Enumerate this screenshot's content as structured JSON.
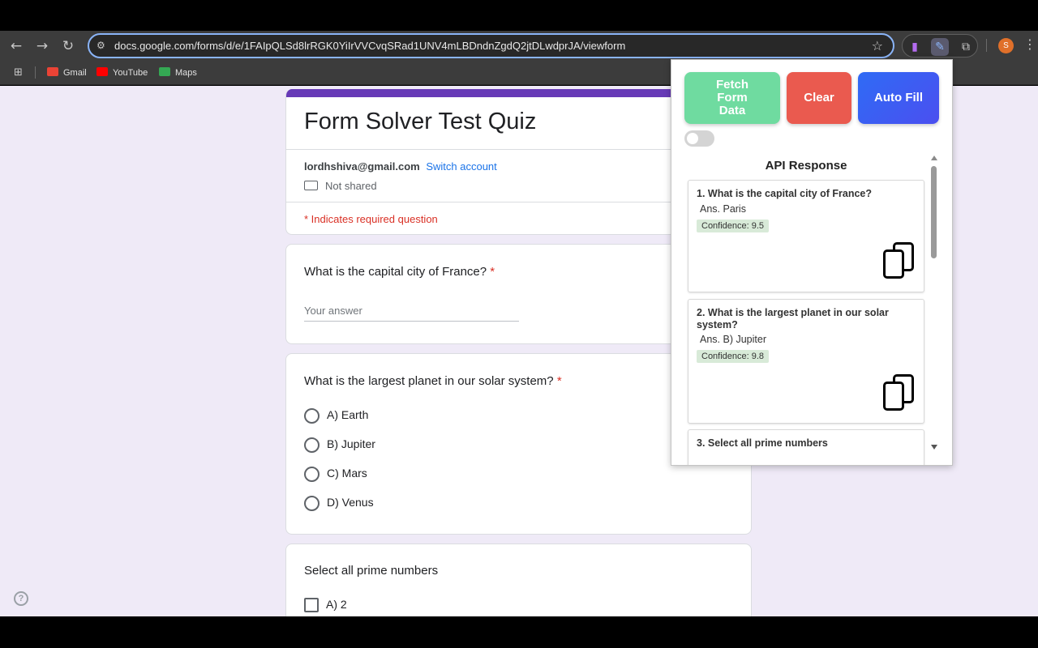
{
  "browser": {
    "url": "docs.google.com/forms/d/e/1FAIpQLSd8lrRGK0YiIrVVCvqSRad1UNV4mLBDndnZgdQ2jtDLwdprJA/viewform",
    "profile_initial": "S",
    "bookmarks": [
      {
        "label": "Gmail",
        "color": "#ea4335"
      },
      {
        "label": "YouTube",
        "color": "#ff0000"
      },
      {
        "label": "Maps",
        "color": "#34a853"
      }
    ]
  },
  "form": {
    "title": "Form Solver Test Quiz",
    "account_email": "lordhshiva@gmail.com",
    "switch_account": "Switch account",
    "not_shared": "Not shared",
    "required_note": "* Indicates required question",
    "questions": [
      {
        "title": "What is the capital city of France?",
        "required_mark": "*",
        "placeholder": "Your answer"
      },
      {
        "title": "What is the largest planet in our solar system?",
        "required_mark": "*",
        "options": [
          "A) Earth",
          "B) Jupiter",
          "C) Mars",
          "D) Venus"
        ]
      },
      {
        "title": "Select all prime numbers",
        "options": [
          "A) 2"
        ]
      }
    ],
    "accent_color": "#673ab7"
  },
  "extension": {
    "buttons": {
      "fetch": "Fetch Form Data",
      "clear": "Clear",
      "autofill": "Auto Fill"
    },
    "colors": {
      "fetch": "#6fdba0",
      "clear": "#ea5a4f",
      "autofill": "#3b5bf5"
    },
    "toggle_on": false,
    "heading": "API Response",
    "responses": [
      {
        "question": "1. What is the capital city of France?",
        "answer": "Ans. Paris",
        "confidence": "Confidence: 9.5"
      },
      {
        "question": "2. What is the largest planet in our solar system?",
        "answer": "Ans. B) Jupiter",
        "confidence": "Confidence: 9.8"
      },
      {
        "question": "3. Select all prime numbers"
      }
    ]
  },
  "help_symbol": "?"
}
